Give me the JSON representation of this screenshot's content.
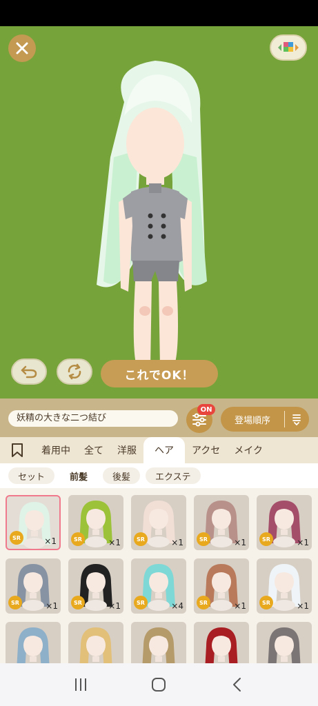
{
  "toolbar": {
    "ok_label": "これでOK！"
  },
  "name_bar": {
    "item_name": "妖精の大きな二つ結び",
    "filter_badge": "ON",
    "sort_label": "登場順序"
  },
  "tabs": [
    "着用中",
    "全て",
    "洋服",
    "ヘア",
    "アクセ",
    "メイク"
  ],
  "active_tab": "ヘア",
  "subtabs": [
    "セット",
    "前髪",
    "後髪",
    "エクステ"
  ],
  "active_subtab": "前髪",
  "items": [
    {
      "rarity": "SR",
      "qty": "×1",
      "hair": "#dff3e6",
      "selected": true
    },
    {
      "rarity": "SR",
      "qty": "×1",
      "hair": "#9cc23a"
    },
    {
      "rarity": "SR",
      "qty": "×1",
      "hair": "#f1dfd6"
    },
    {
      "rarity": "SR",
      "qty": "×1",
      "hair": "#b8918a"
    },
    {
      "rarity": "SR",
      "qty": "×1",
      "hair": "#a44e6a"
    },
    {
      "rarity": "SR",
      "qty": "×1",
      "hair": "#8792a3"
    },
    {
      "rarity": "SR",
      "qty": "×1",
      "hair": "#222222"
    },
    {
      "rarity": "SR",
      "qty": "×4",
      "hair": "#7ed8d6"
    },
    {
      "rarity": "SR",
      "qty": "×1",
      "hair": "#b97a5c"
    },
    {
      "rarity": "SR",
      "qty": "×1",
      "hair": "#eef4f7"
    },
    {
      "rarity": "",
      "qty": "",
      "hair": "#8fb0c9"
    },
    {
      "rarity": "",
      "qty": "",
      "hair": "#e2c07a"
    },
    {
      "rarity": "",
      "qty": "",
      "hair": "#b59a6a"
    },
    {
      "rarity": "",
      "qty": "",
      "hair": "#a81e22"
    },
    {
      "rarity": "",
      "qty": "",
      "hair": "#7b7575"
    }
  ],
  "colors": {
    "stage": "#76a33a",
    "accent": "#c29548",
    "badge": "#e8453c",
    "selected_border": "#f07a8c",
    "rarity": "#e8a91e"
  },
  "icons": [
    "close-icon",
    "color-palette-icon",
    "undo-icon",
    "rotate-icon",
    "filter-sliders-icon",
    "sort-order-icon",
    "bookmark-icon",
    "recents-icon",
    "home-icon",
    "back-icon"
  ]
}
